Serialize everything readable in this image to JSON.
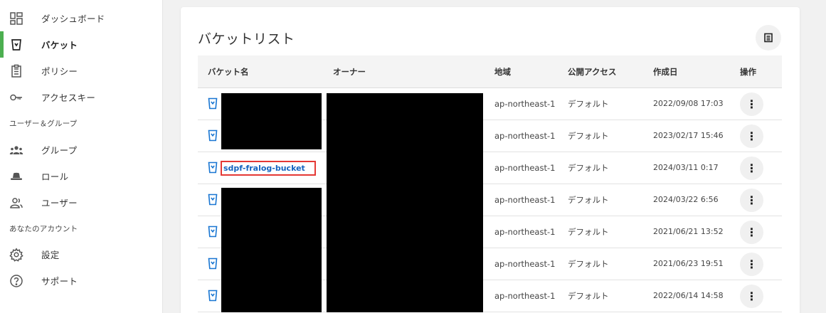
{
  "sidebar": {
    "items": [
      {
        "label": "ダッシュボード",
        "icon": "dashboard-icon"
      },
      {
        "label": "バケット",
        "icon": "bucket-icon",
        "active": true
      },
      {
        "label": "ポリシー",
        "icon": "policy-icon"
      },
      {
        "label": "アクセスキー",
        "icon": "key-icon"
      }
    ],
    "section_users": "ユーザー＆グループ",
    "user_items": [
      {
        "label": "グループ",
        "icon": "group-icon"
      },
      {
        "label": "ロール",
        "icon": "role-icon"
      },
      {
        "label": "ユーザー",
        "icon": "user-icon"
      }
    ],
    "section_account": "あなたのアカウント",
    "account_items": [
      {
        "label": "設定",
        "icon": "gear-icon"
      },
      {
        "label": "サポート",
        "icon": "help-icon"
      }
    ]
  },
  "main": {
    "title": "バケットリスト",
    "columns": [
      "バケット名",
      "オーナー",
      "地域",
      "公開アクセス",
      "作成日",
      "操作"
    ],
    "rows": [
      {
        "name": "",
        "region": "ap-northeast-1",
        "access": "デフォルト",
        "created": "2022/09/08 17:03"
      },
      {
        "name": "",
        "region": "ap-northeast-1",
        "access": "デフォルト",
        "created": "2023/02/17 15:46"
      },
      {
        "name": "sdpf-fralog-bucket",
        "region": "ap-northeast-1",
        "access": "デフォルト",
        "created": "2024/03/11 0:17"
      },
      {
        "name": "",
        "region": "ap-northeast-1",
        "access": "デフォルト",
        "created": "2024/03/22 6:56"
      },
      {
        "name": "",
        "region": "ap-northeast-1",
        "access": "デフォルト",
        "created": "2021/06/21 13:52"
      },
      {
        "name": "",
        "region": "ap-northeast-1",
        "access": "デフォルト",
        "created": "2021/06/23 19:51"
      },
      {
        "name": "",
        "region": "ap-northeast-1",
        "access": "デフォルト",
        "created": "2022/06/14 14:58"
      }
    ],
    "menu_glyph": "⋮"
  },
  "colors": {
    "accent": "#4caf50",
    "link": "#1565c0",
    "highlight": "#e53935",
    "bucket_icon": "#1976d2"
  }
}
